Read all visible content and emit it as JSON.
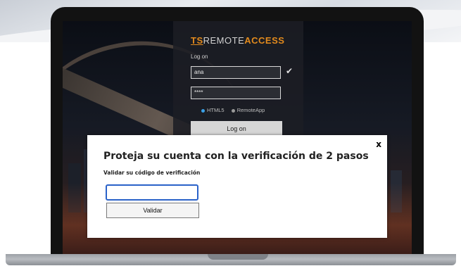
{
  "background": {
    "accent": "#e28a1d"
  },
  "login_panel": {
    "brand": {
      "ts": "TS",
      "remote": "REMOTE",
      "access": "ACCESS"
    },
    "title": "Log on",
    "username_value": "ana",
    "password_value": "****",
    "check_icon": "check-icon",
    "mode_html5": "HTML5",
    "mode_remoteapp": "RemoteApp",
    "logon_button": "Log on"
  },
  "modal": {
    "close_label": "x",
    "title": "Proteja su cuenta con la verificación de 2 pasos",
    "subtitle": "Validar su código de verificación",
    "code_value": "",
    "validate_button": "Validar"
  },
  "colors": {
    "modal_input_border": "#2a62c9",
    "radio_selected": "#3aa0e6"
  }
}
